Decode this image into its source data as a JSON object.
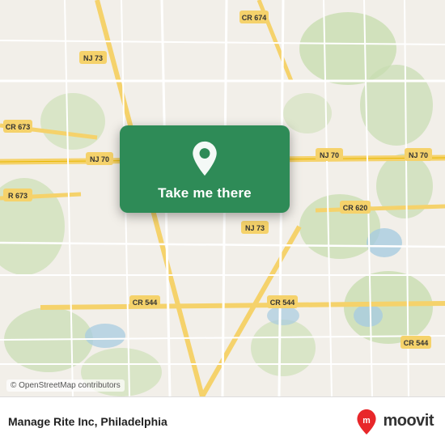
{
  "map": {
    "attribution": "© OpenStreetMap contributors"
  },
  "card": {
    "button_label": "Take me there",
    "pin_icon": "location-pin"
  },
  "bottom_bar": {
    "place_name": "Manage Rite Inc, Philadelphia",
    "logo_text": "moovit"
  }
}
